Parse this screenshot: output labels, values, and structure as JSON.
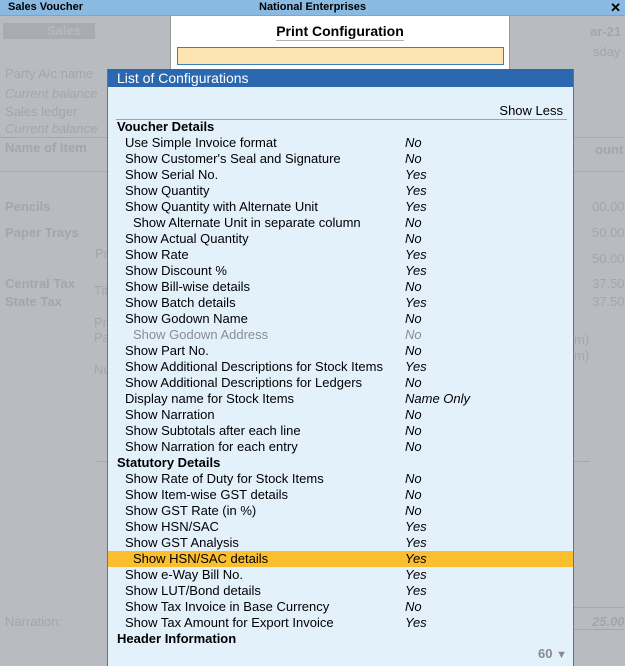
{
  "window": {
    "title_left": "Sales Voucher",
    "title_center": "National Enterprises",
    "close_label": "✕"
  },
  "background": {
    "voucher_type": "Sales",
    "date_partial": "ar-21",
    "day_partial": "sday",
    "party_label": "Party A/c name",
    "current_balance_1": "Current balance",
    "sales_ledger_label": "Sales ledger",
    "current_balance_2": "Current balance",
    "name_of_item_header": "Name of Item",
    "amount_header_partial": "ount",
    "items": [
      {
        "name": "Pencils",
        "amount": "00.00"
      },
      {
        "name": "Paper Trays",
        "amount": "50.00"
      }
    ],
    "extra_amount": "50.00",
    "taxes": [
      {
        "name": "Central Tax",
        "amount": "37.50"
      },
      {
        "name": "State Tax",
        "amount": "37.50"
      }
    ],
    "partial_labels": [
      "Pr",
      "Tit",
      "Pri",
      "Pa",
      "Nu"
    ],
    "partial_right": [
      "m)",
      "m)"
    ],
    "narration_label": "Narration:",
    "total_amount": "25.00"
  },
  "print_config": {
    "title": "Print Configuration",
    "search_value": ""
  },
  "list": {
    "title": "List of Configurations",
    "show_less_label": "Show Less",
    "sections": [
      {
        "title": "Voucher Details",
        "items": [
          {
            "label": "Use Simple Invoice format",
            "value": "No"
          },
          {
            "label": "Show Customer's Seal and Signature",
            "value": "No"
          },
          {
            "label": "Show Serial No.",
            "value": "Yes"
          },
          {
            "label": "Show Quantity",
            "value": "Yes"
          },
          {
            "label": "Show Quantity with Alternate Unit",
            "value": "Yes"
          },
          {
            "label": "Show Alternate Unit in separate column",
            "value": "No",
            "sub": true
          },
          {
            "label": "Show Actual Quantity",
            "value": "No"
          },
          {
            "label": "Show Rate",
            "value": "Yes"
          },
          {
            "label": "Show Discount %",
            "value": "Yes"
          },
          {
            "label": "Show Bill-wise details",
            "value": "No"
          },
          {
            "label": "Show Batch details",
            "value": "Yes"
          },
          {
            "label": "Show Godown Name",
            "value": "No"
          },
          {
            "label": "Show Godown Address",
            "value": "No",
            "sub": true,
            "disabled": true
          },
          {
            "label": "Show Part No.",
            "value": "No"
          },
          {
            "label": "Show Additional Descriptions for Stock Items",
            "value": "Yes"
          },
          {
            "label": "Show Additional Descriptions for Ledgers",
            "value": "No"
          },
          {
            "label": "Display name for Stock Items",
            "value": "Name Only"
          },
          {
            "label": "Show Narration",
            "value": "No"
          },
          {
            "label": "Show Subtotals after each line",
            "value": "No"
          },
          {
            "label": "Show Narration for each entry",
            "value": "No"
          }
        ]
      },
      {
        "title": "Statutory Details",
        "items": [
          {
            "label": "Show Rate of Duty for Stock Items",
            "value": "No"
          },
          {
            "label": "Show Item-wise GST details",
            "value": "No"
          },
          {
            "label": "Show GST Rate (in %)",
            "value": "No"
          },
          {
            "label": "Show HSN/SAC",
            "value": "Yes"
          },
          {
            "label": "Show GST Analysis",
            "value": "Yes"
          },
          {
            "label": "Show HSN/SAC details",
            "value": "Yes",
            "sub": true,
            "selected": true
          },
          {
            "label": "Show e-Way Bill No.",
            "value": "Yes"
          },
          {
            "label": "Show LUT/Bond details",
            "value": "Yes"
          },
          {
            "label": "Show Tax Invoice in Base Currency",
            "value": "No"
          },
          {
            "label": "Show Tax Amount for Export Invoice",
            "value": "Yes"
          }
        ]
      },
      {
        "title": "Header Information",
        "items": []
      }
    ],
    "pager": {
      "count": "60",
      "arrow_icon": "▼"
    }
  },
  "colors": {
    "highlight": "#fbbe2f",
    "header_blue": "#2c68b0",
    "panel_bg": "#e3f1fb",
    "titlebar": "#8ab9e2"
  }
}
